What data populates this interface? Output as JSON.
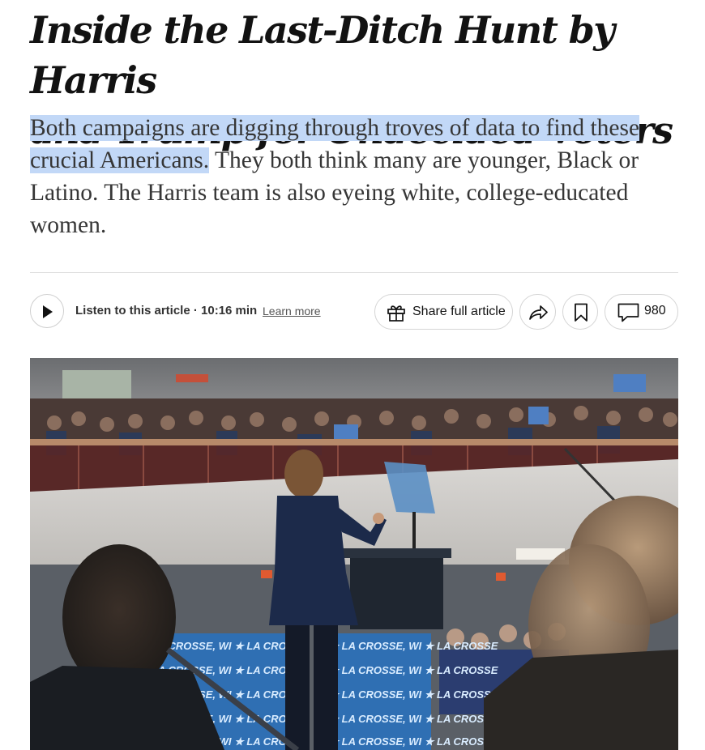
{
  "article": {
    "headline_line1": "Inside the Last-Ditch Hunt by Harris",
    "headline_line2": "and Trump for Undecided Voters",
    "summary_highlighted": "Both campaigns are digging through troves of data to find these crucial Americans.",
    "summary_rest": " They both think many are younger, Black or Latino. The Harris team is also eyeing white, college-educated women."
  },
  "toolbar": {
    "listen_label": "Listen to this article · 10:16 min",
    "learn_more": "Learn more",
    "share_full_label": "Share full article",
    "comment_count": "980",
    "icons": [
      "play-icon",
      "gift-icon",
      "share-arrow-icon",
      "bookmark-icon",
      "comment-icon"
    ]
  },
  "photo": {
    "banner_text": "LA CROSSE, WI ★ LA CROSSE, WI ★ LA CROSSE, WI ★ LA CROSSE",
    "colors": {
      "banner_blue": "#2f6fb3",
      "suit_navy": "#1c2a4a",
      "railing": "#6a2a26"
    }
  }
}
